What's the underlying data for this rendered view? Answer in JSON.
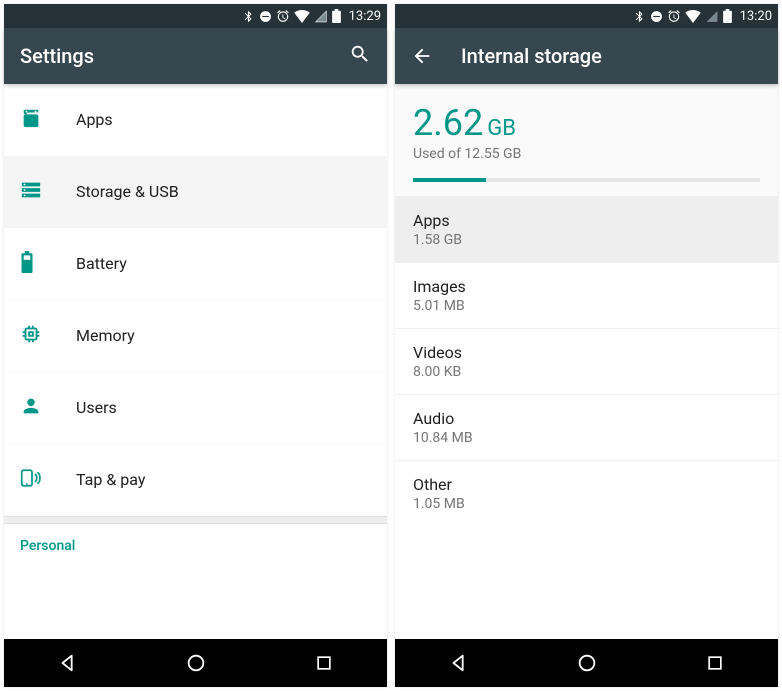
{
  "colors": {
    "accent": "#009688",
    "appbar": "#37474F",
    "status": "#263238"
  },
  "left": {
    "status_time": "13:29",
    "title": "Settings",
    "items": [
      {
        "label": "Apps",
        "icon": "apps",
        "selected": false
      },
      {
        "label": "Storage & USB",
        "icon": "storage",
        "selected": true
      },
      {
        "label": "Battery",
        "icon": "battery",
        "selected": false
      },
      {
        "label": "Memory",
        "icon": "memory",
        "selected": false
      },
      {
        "label": "Users",
        "icon": "users",
        "selected": false
      },
      {
        "label": "Tap & pay",
        "icon": "tap-pay",
        "selected": false
      }
    ],
    "section_label": "Personal"
  },
  "right": {
    "status_time": "13:20",
    "title": "Internal storage",
    "used_value": "2.62",
    "used_unit": "GB",
    "used_subtext": "Used of 12.55 GB",
    "progress_percent": 21,
    "rows": [
      {
        "title": "Apps",
        "sub": "1.58 GB",
        "selected": true
      },
      {
        "title": "Images",
        "sub": "5.01 MB",
        "selected": false
      },
      {
        "title": "Videos",
        "sub": "8.00 KB",
        "selected": false
      },
      {
        "title": "Audio",
        "sub": "10.84 MB",
        "selected": false
      },
      {
        "title": "Other",
        "sub": "1.05 MB",
        "selected": false
      }
    ]
  }
}
